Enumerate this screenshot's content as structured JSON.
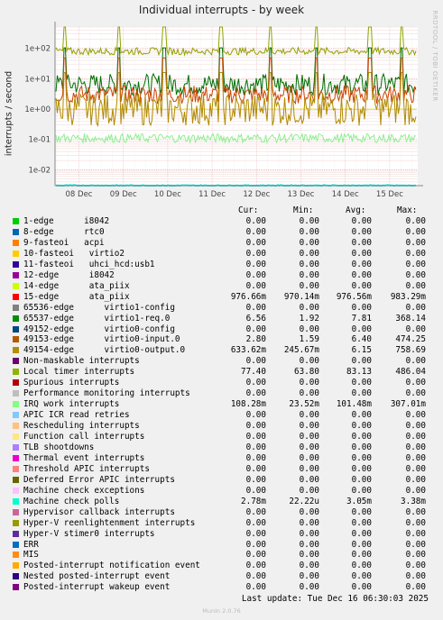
{
  "title": "Individual interrupts - by week",
  "side_label": "RRDTOOL / TOBI OETIKER",
  "last_update": "Last update: Tue Dec 16 06:30:03 2025",
  "footer": "Munin 2.0.76",
  "columns": [
    "Cur:",
    "Min:",
    "Avg:",
    "Max:"
  ],
  "chart_data": {
    "type": "line",
    "title": "Individual interrupts - by week",
    "ylabel": "interrupts / second",
    "yscale": "log",
    "ylim": [
      0.003,
      500
    ],
    "y_ticks": [
      "1e-02",
      "1e-01",
      "1e+00",
      "1e+01",
      "1e+02"
    ],
    "y_tick_values": [
      0.01,
      0.1,
      1,
      10,
      100
    ],
    "x_ticks": [
      "08 Dec",
      "09 Dec",
      "10 Dec",
      "11 Dec",
      "12 Dec",
      "13 Dec",
      "14 Dec",
      "15 Dec"
    ],
    "grid": true,
    "series": [
      {
        "name": "15-edge",
        "description": "ata_piix",
        "color": "#e7e700",
        "level": 0.98
      },
      {
        "name": "65537-edge",
        "description": "virtio1-req.0",
        "color": "#006e00",
        "level": 6.5
      },
      {
        "name": "49153-edge",
        "description": "virtio0-input.0",
        "color": "#cc4400",
        "level": 3.0
      },
      {
        "name": "49154-edge",
        "description": "virtio0-output.0",
        "color": "#b08a00",
        "level": 1.0
      },
      {
        "name": "Local timer interrupts",
        "color": "#8fa500",
        "level": 80
      },
      {
        "name": "IRQ work interrupts",
        "color": "#90ee90",
        "level": 0.11
      },
      {
        "name": "Machine check polls",
        "color": "#00e5e5",
        "level": 0.003
      }
    ]
  },
  "legend": [
    {
      "name": "1-edge      i8042",
      "color": "#00cc00",
      "cur": "0.00",
      "min": "0.00",
      "avg": "0.00",
      "max": "0.00"
    },
    {
      "name": "8-edge      rtc0",
      "color": "#0066b3",
      "cur": "0.00",
      "min": "0.00",
      "avg": "0.00",
      "max": "0.00"
    },
    {
      "name": "9-fasteoi   acpi",
      "color": "#ff8000",
      "cur": "0.00",
      "min": "0.00",
      "avg": "0.00",
      "max": "0.00"
    },
    {
      "name": "10-fasteoi   virtio2",
      "color": "#ffcc00",
      "cur": "0.00",
      "min": "0.00",
      "avg": "0.00",
      "max": "0.00"
    },
    {
      "name": "11-fasteoi   uhci_hcd:usb1",
      "color": "#330099",
      "cur": "0.00",
      "min": "0.00",
      "avg": "0.00",
      "max": "0.00"
    },
    {
      "name": "12-edge      i8042",
      "color": "#990099",
      "cur": "0.00",
      "min": "0.00",
      "avg": "0.00",
      "max": "0.00"
    },
    {
      "name": "14-edge      ata_piix",
      "color": "#ccff00",
      "cur": "0.00",
      "min": "0.00",
      "avg": "0.00",
      "max": "0.00"
    },
    {
      "name": "15-edge      ata_piix",
      "color": "#ff0000",
      "cur": "976.66m",
      "min": "970.14m",
      "avg": "976.56m",
      "max": "983.29m"
    },
    {
      "name": "65536-edge      virtio1-config",
      "color": "#808080",
      "cur": "0.00",
      "min": "0.00",
      "avg": "0.00",
      "max": "0.00"
    },
    {
      "name": "65537-edge      virtio1-req.0",
      "color": "#008f00",
      "cur": "6.56",
      "min": "1.92",
      "avg": "7.81",
      "max": "368.14"
    },
    {
      "name": "49152-edge      virtio0-config",
      "color": "#00487d",
      "cur": "0.00",
      "min": "0.00",
      "avg": "0.00",
      "max": "0.00"
    },
    {
      "name": "49153-edge      virtio0-input.0",
      "color": "#b35a00",
      "cur": "2.80",
      "min": "1.59",
      "avg": "6.40",
      "max": "474.25"
    },
    {
      "name": "49154-edge      virtio0-output.0",
      "color": "#b38f00",
      "cur": "633.62m",
      "min": "245.67m",
      "avg": "6.15",
      "max": "758.69"
    },
    {
      "name": "Non-maskable interrupts",
      "color": "#6b006b",
      "cur": "0.00",
      "min": "0.00",
      "avg": "0.00",
      "max": "0.00"
    },
    {
      "name": "Local timer interrupts",
      "color": "#8fb300",
      "cur": "77.40",
      "min": "63.80",
      "avg": "83.13",
      "max": "486.04"
    },
    {
      "name": "Spurious interrupts",
      "color": "#b30000",
      "cur": "0.00",
      "min": "0.00",
      "avg": "0.00",
      "max": "0.00"
    },
    {
      "name": "Performance monitoring interrupts",
      "color": "#bebebe",
      "cur": "0.00",
      "min": "0.00",
      "avg": "0.00",
      "max": "0.00"
    },
    {
      "name": "IRQ work interrupts",
      "color": "#80ff80",
      "cur": "108.28m",
      "min": "23.52m",
      "avg": "101.48m",
      "max": "307.01m"
    },
    {
      "name": "APIC ICR read retries",
      "color": "#80c9ff",
      "cur": "0.00",
      "min": "0.00",
      "avg": "0.00",
      "max": "0.00"
    },
    {
      "name": "Rescheduling interrupts",
      "color": "#ffc080",
      "cur": "0.00",
      "min": "0.00",
      "avg": "0.00",
      "max": "0.00"
    },
    {
      "name": "Function call interrupts",
      "color": "#ffe680",
      "cur": "0.00",
      "min": "0.00",
      "avg": "0.00",
      "max": "0.00"
    },
    {
      "name": "TLB shootdowns",
      "color": "#aa80ff",
      "cur": "0.00",
      "min": "0.00",
      "avg": "0.00",
      "max": "0.00"
    },
    {
      "name": "Thermal event interrupts",
      "color": "#ee00cc",
      "cur": "0.00",
      "min": "0.00",
      "avg": "0.00",
      "max": "0.00"
    },
    {
      "name": "Threshold APIC interrupts",
      "color": "#ff8080",
      "cur": "0.00",
      "min": "0.00",
      "avg": "0.00",
      "max": "0.00"
    },
    {
      "name": "Deferred Error APIC interrupts",
      "color": "#666600",
      "cur": "0.00",
      "min": "0.00",
      "avg": "0.00",
      "max": "0.00"
    },
    {
      "name": "Machine check exceptions",
      "color": "#ffbfff",
      "cur": "0.00",
      "min": "0.00",
      "avg": "0.00",
      "max": "0.00"
    },
    {
      "name": "Machine check polls",
      "color": "#00ffcc",
      "cur": "2.78m",
      "min": "22.22u",
      "avg": "3.05m",
      "max": "3.38m"
    },
    {
      "name": "Hypervisor callback interrupts",
      "color": "#cc6699",
      "cur": "0.00",
      "min": "0.00",
      "avg": "0.00",
      "max": "0.00"
    },
    {
      "name": "Hyper-V reenlightenment interrupts",
      "color": "#999900",
      "cur": "0.00",
      "min": "0.00",
      "avg": "0.00",
      "max": "0.00"
    },
    {
      "name": "Hyper-V stimer0 interrupts",
      "color": "#5c2e99",
      "cur": "0.00",
      "min": "0.00",
      "avg": "0.00",
      "max": "0.00"
    },
    {
      "name": "ERR",
      "color": "#0070c0",
      "cur": "0.00",
      "min": "0.00",
      "avg": "0.00",
      "max": "0.00"
    },
    {
      "name": "MIS",
      "color": "#ff8c1a",
      "cur": "0.00",
      "min": "0.00",
      "avg": "0.00",
      "max": "0.00"
    },
    {
      "name": "Posted-interrupt notification event",
      "color": "#ffaa00",
      "cur": "0.00",
      "min": "0.00",
      "avg": "0.00",
      "max": "0.00"
    },
    {
      "name": "Nested posted-interrupt event",
      "color": "#2e0080",
      "cur": "0.00",
      "min": "0.00",
      "avg": "0.00",
      "max": "0.00"
    },
    {
      "name": "Posted-interrupt wakeup event",
      "color": "#800080",
      "cur": "0.00",
      "min": "0.00",
      "avg": "0.00",
      "max": "0.00"
    }
  ]
}
